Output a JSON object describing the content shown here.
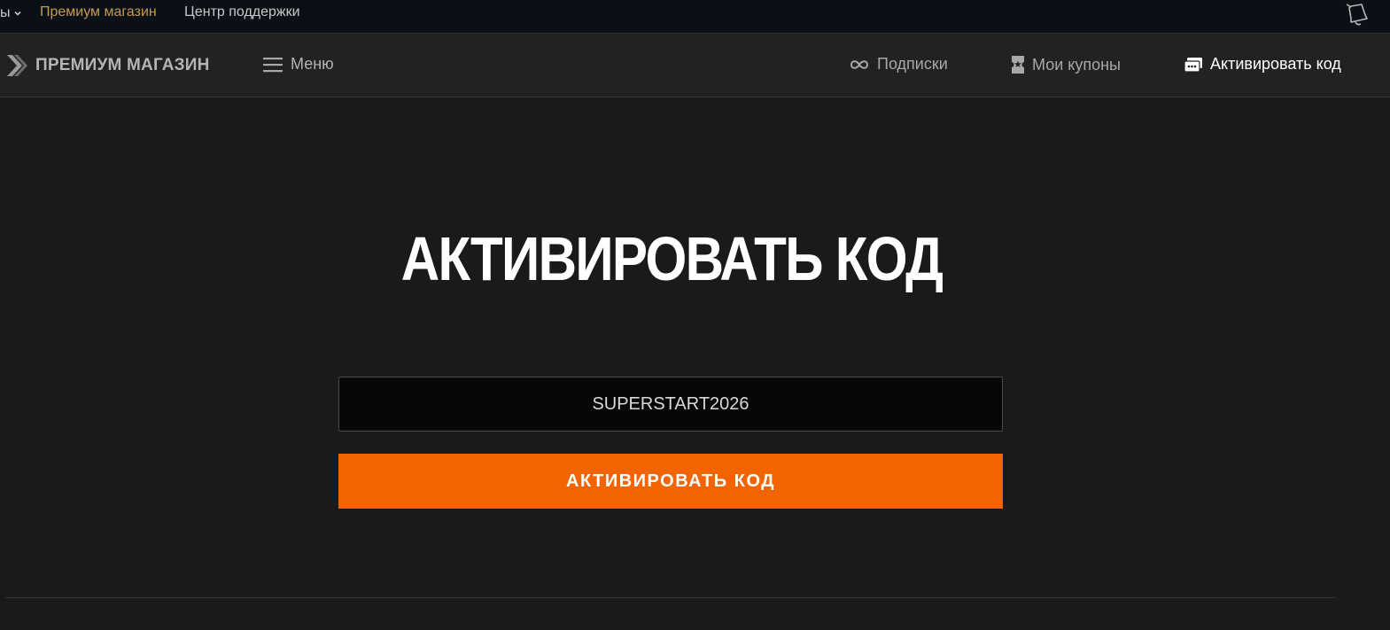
{
  "topbar": {
    "games_label": "ы",
    "premium_link": "Премиум магазин",
    "support_link": "Центр поддержки"
  },
  "header": {
    "logo_text": "ПРЕМИУМ МАГАЗИН",
    "menu_label": "Меню",
    "nav": {
      "subscriptions": "Подписки",
      "coupons": "Мои купоны",
      "activate": "Активировать код"
    }
  },
  "main": {
    "title": "АКТИВИРОВАТЬ КОД",
    "code_value": "SUPERSTART2026",
    "activate_button": "АКТИВИРОВАТЬ КОД"
  },
  "colors": {
    "accent": "#f26400",
    "premium_link": "#c89a4a",
    "background": "#1a1a1a",
    "topbar": "#0b1016"
  }
}
